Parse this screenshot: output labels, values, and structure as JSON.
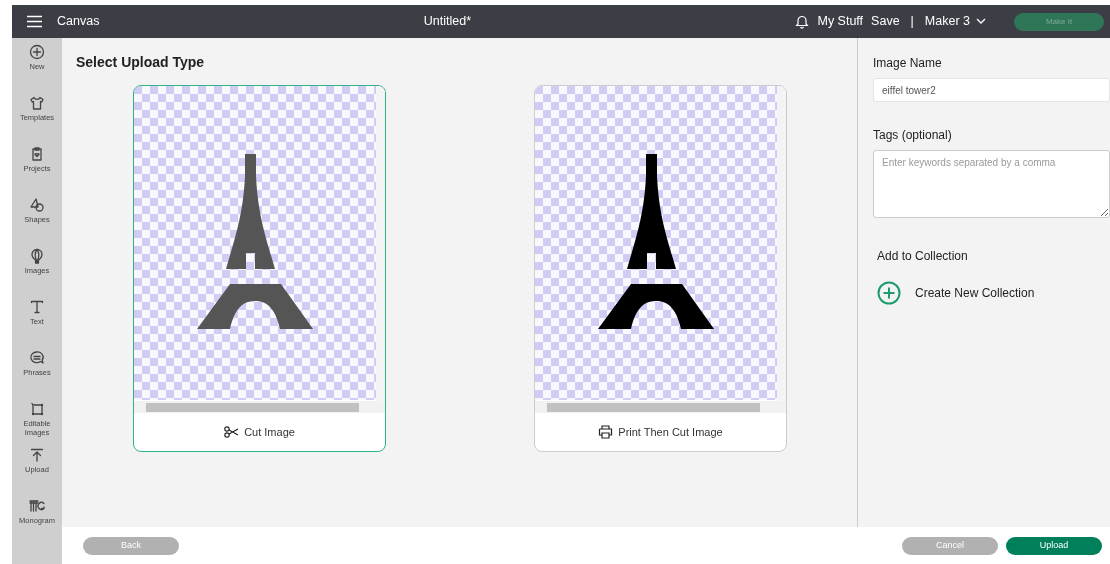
{
  "header": {
    "app": "Canvas",
    "title": "Untitled*",
    "links": [
      "My Stuff",
      "Save"
    ],
    "separator": "|",
    "machine": "Maker 3",
    "action": {
      "label": "Make It",
      "disabled": true
    }
  },
  "sidebar": {
    "items": [
      {
        "label": "New",
        "kind": "new"
      },
      {
        "label": "Templates",
        "kind": "templates"
      },
      {
        "label": "Projects",
        "kind": "projects"
      },
      {
        "label": "Shapes",
        "kind": "shapes"
      },
      {
        "label": "Images",
        "kind": "images"
      },
      {
        "label": "Text",
        "kind": "text"
      },
      {
        "label": "Phrases",
        "kind": "phrases"
      },
      {
        "label": "Editable Images",
        "kind": "editable"
      },
      {
        "label": "Upload",
        "kind": "upload"
      },
      {
        "label": "Monogram",
        "kind": "monogram"
      }
    ]
  },
  "main": {
    "heading": "Select Upload Type",
    "options": [
      {
        "label": "Cut Image",
        "kind": "cut",
        "selected": true
      },
      {
        "label": "Print Then Cut Image",
        "kind": "print",
        "selected": false
      }
    ]
  },
  "panel": {
    "name_label": "Image Name",
    "name_value": "eiffel tower2",
    "tags_label": "Tags (optional)",
    "tags_placeholder": "Enter keywords separated by a comma",
    "collection_label": "Add to Collection",
    "create_label": "Create New Collection"
  },
  "footer": {
    "back": "Back",
    "cancel": "Cancel",
    "upload": "Upload"
  }
}
